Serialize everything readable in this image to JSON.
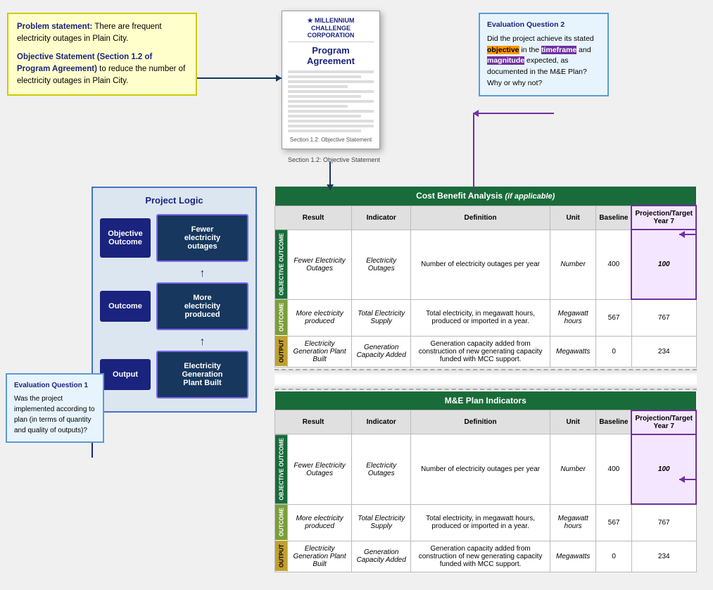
{
  "problem_box": {
    "problem_label": "Problem statement:",
    "problem_text": " There are frequent electricity outages in Plain City.",
    "objective_label": "Objective Statement (Section 1.2 of Program Agreement)",
    "objective_text": " to reduce the number of electricity outages in Plain City."
  },
  "program_agreement": {
    "logo_text": "MILLENNIUM\nCHALLENGE CORPORATION",
    "title": "Program Agreement",
    "section_label": "Section 1.2: Objective Statement"
  },
  "eval_q2": {
    "title": "Evaluation Question 2",
    "text_before": "Did the project achieve its stated ",
    "highlight1": "objective",
    "text_mid1": " in the ",
    "highlight2": "timeframe",
    "text_mid2": " and ",
    "highlight3": "magnitude",
    "text_after": " expected, as documented in the M&E Plan? Why or why not?"
  },
  "eval_q1": {
    "title": "Evaluation Question 1",
    "text": "Was the project implemented according to plan (in terms of quantity and quality of outputs)?"
  },
  "project_logic": {
    "title": "Project Logic",
    "rows": [
      {
        "label": "Objective Outcome",
        "result": "Fewer electricity outages"
      },
      {
        "label": "Outcome",
        "result": "More electricity produced"
      },
      {
        "label": "Output",
        "result": "Electricity Generation Plant Built"
      }
    ]
  },
  "cba_table": {
    "title": "Cost Benefit Analysis",
    "title_suffix": " (if applicable)",
    "columns": [
      "Result",
      "Indicator",
      "Definition",
      "Unit",
      "Baseline",
      "Projection/Target Year 7"
    ],
    "rows": [
      {
        "section": "OBJECTIVE OUTCOME",
        "result": "Fewer Electricity Outages",
        "indicator": "Electricity Outages",
        "definition": "Number of electricity outages per year",
        "unit": "Number",
        "baseline": "400",
        "projection": "100"
      },
      {
        "section": "OUTCOME",
        "result": "More electricity produced",
        "indicator": "Total Electricity Supply",
        "definition": "Total electricity, in megawatt hours, produced or imported in a year.",
        "unit": "Megawatt hours",
        "baseline": "567",
        "projection": "767"
      },
      {
        "section": "OUTPUT",
        "result": "Electricity Generation Plant Built",
        "indicator": "Generation Capacity Added",
        "definition": "Generation capacity added from construction of new generating capacity funded with MCC support.",
        "unit": "Megawatts",
        "baseline": "0",
        "projection": "234"
      }
    ]
  },
  "me_table": {
    "title": "M&E Plan Indicators",
    "columns": [
      "Result",
      "Indicator",
      "Definition",
      "Unit",
      "Baseline",
      "Projection/Target Year 7"
    ],
    "rows": [
      {
        "section": "OBJECTIVE OUTCOME",
        "result": "Fewer Electricity Outages",
        "indicator": "Electricity Outages",
        "definition": "Number of electricity outages per year",
        "unit": "Number",
        "baseline": "400",
        "projection": "100"
      },
      {
        "section": "OUTCOME",
        "result": "More electricity produced",
        "indicator": "Total Electricity Supply",
        "definition": "Total electricity, in megawatt hours, produced or imported in a year.",
        "unit": "Megawatt hours",
        "baseline": "567",
        "projection": "767"
      },
      {
        "section": "OUTPUT",
        "result": "Electricity Generation Plant Built",
        "indicator": "Generation Capacity Added",
        "definition": "Generation capacity added from construction of new generating capacity funded with MCC support.",
        "unit": "Megawatts",
        "baseline": "0",
        "projection": "234"
      }
    ]
  }
}
